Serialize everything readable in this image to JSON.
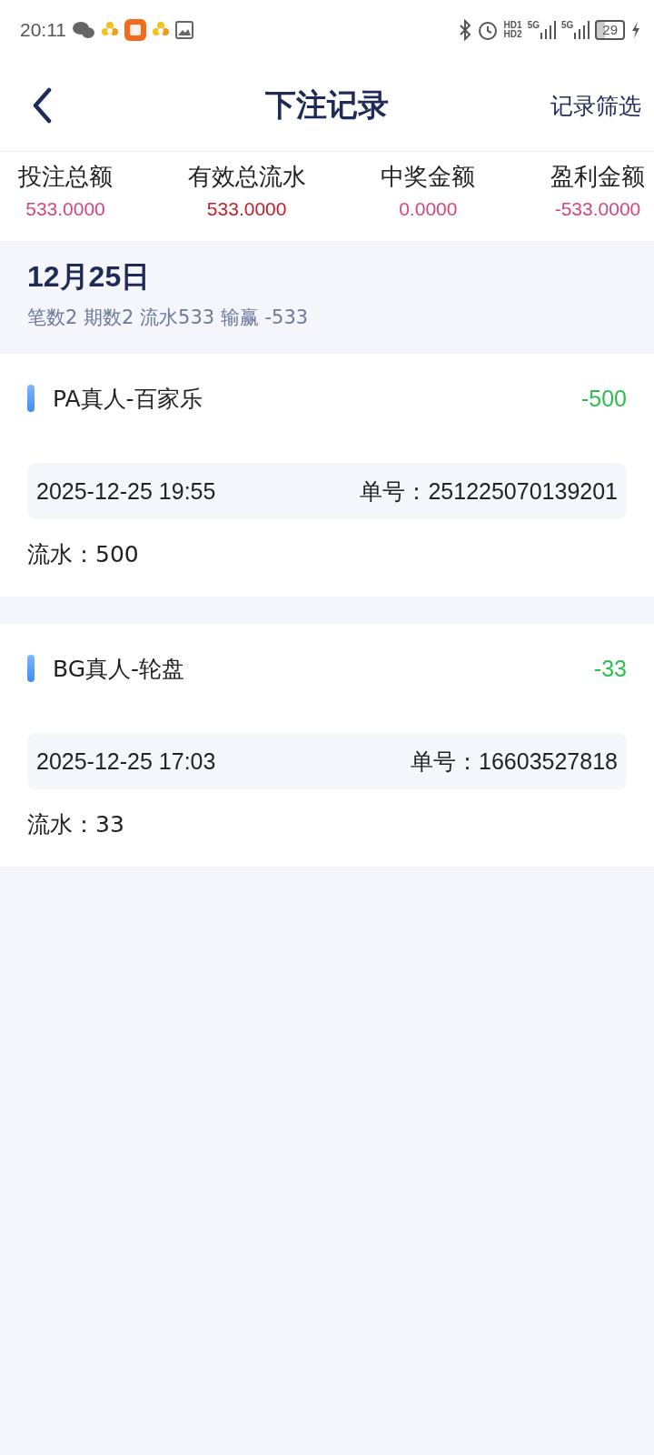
{
  "status_bar": {
    "time": "20:11",
    "hd_labels": [
      "HD1",
      "HD2"
    ],
    "signals": [
      "5G",
      "5G"
    ],
    "battery": "29"
  },
  "header": {
    "title": "下注记录",
    "action": "记录筛选"
  },
  "summary": [
    {
      "label": "投注总额",
      "value": "533.0000",
      "color": "#d9467c"
    },
    {
      "label": "有效总流水",
      "value": "533.0000",
      "color": "#c41f2a"
    },
    {
      "label": "中奖金额",
      "value": "0.0000",
      "color": "#d9467c"
    },
    {
      "label": "盈利金额",
      "value": "-533.0000",
      "color": "#d9467c"
    }
  ],
  "day": {
    "date": "12月25日",
    "stats": "笔数2 期数2 流水533 输赢 -533"
  },
  "records": [
    {
      "game": "PA真人-百家乐",
      "result": "-500",
      "time": "2025-12-25 19:55",
      "order_label": "单号：",
      "order": "251225070139201",
      "turnover_label": "流水：",
      "turnover": "500"
    },
    {
      "game": "BG真人-轮盘",
      "result": "-33",
      "time": "2025-12-25 17:03",
      "order_label": "单号：",
      "order": "16603527818",
      "turnover_label": "流水：",
      "turnover": "33"
    }
  ]
}
